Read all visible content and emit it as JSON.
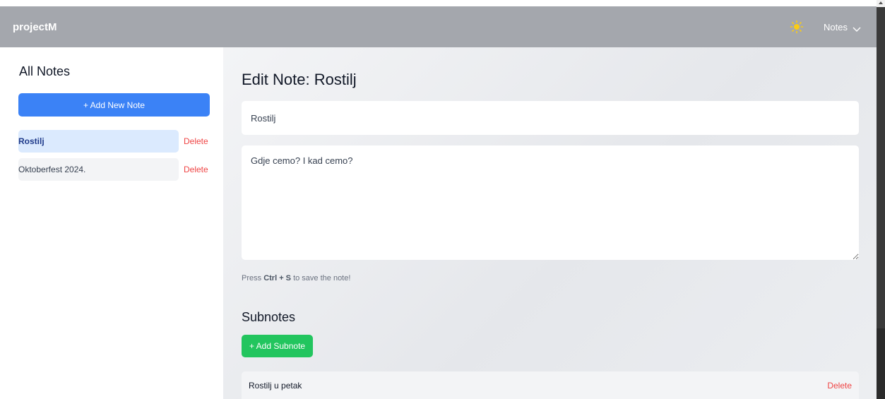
{
  "header": {
    "brand": "projectM",
    "theme_icon": "sun-icon",
    "notes_menu_label": "Notes",
    "sun_color": "#facc15"
  },
  "sidebar": {
    "title": "All Notes",
    "add_button_label": "+ Add New Note",
    "notes": [
      {
        "title": "Rostilj",
        "delete_label": "Delete"
      },
      {
        "title": "Oktoberfest 2024.",
        "delete_label": "Delete"
      }
    ]
  },
  "editor": {
    "heading": "Edit Note: Rostilj",
    "title_value": "Rostilj",
    "body_value": "Gdje cemo? I kad cemo?",
    "hint_prefix": "Press",
    "hint_keys": "Ctrl + S",
    "hint_suffix": "to save the note!"
  },
  "subnotes": {
    "heading": "Subnotes",
    "add_button_label": "+ Add Subnote",
    "items": [
      {
        "title": "Rostilj u petak",
        "delete_label": "Delete"
      }
    ]
  },
  "colors": {
    "navbar": "#a4a7ad",
    "primary": "#3b82f6",
    "success": "#22c55e",
    "danger": "#ef4444"
  }
}
